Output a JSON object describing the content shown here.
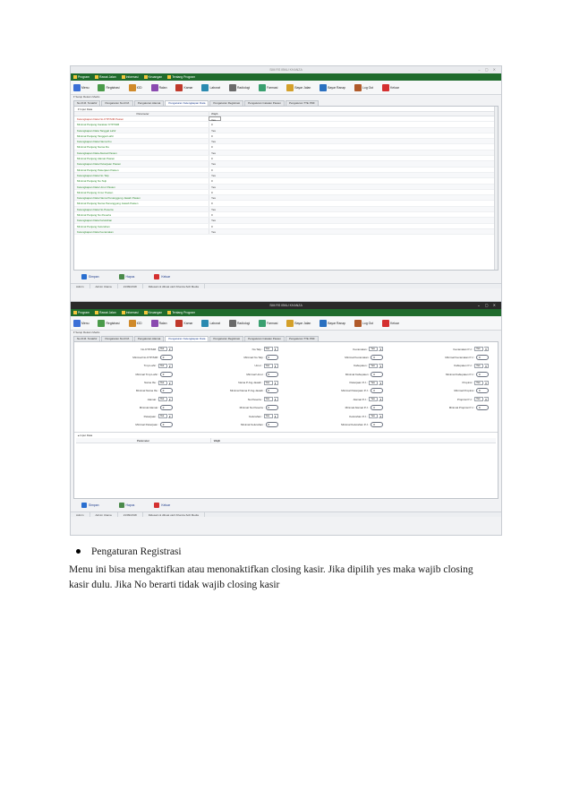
{
  "screenshot1": {
    "window_title": "SIM RS IBNU KHANZA",
    "menu": [
      "Program",
      "Rawat Jalan",
      "Informasi",
      "Keuangan",
      "Tentang Program"
    ],
    "toolbar": [
      "Menu",
      "Registrasi",
      "IGD",
      "Ralan",
      "Kamar",
      "Laborat",
      "Radiologi",
      "Farmasi",
      "Bayar Jalan",
      "Bayar Ranap",
      "Log Out",
      "Keluar"
    ],
    "breadcrumb": "Setup Rekam Medis",
    "tabs": [
      "No.R.M. Terakhir",
      "Pengaturan No.R.M.",
      "Pengaturan Alamat",
      "Pengaturan Kelengkapan Data",
      "Pengaturan Registrasi",
      "Pengaturan Catatan Pasien",
      "Pengaturan TTE PDF"
    ],
    "active_tab": 3,
    "grid_title": "Input Data",
    "grid_headers": {
      "param": "Parameter",
      "value": "Wajib"
    },
    "rows": [
      {
        "param": "Kelengkapan Data No.KTP/SIM Pasien",
        "value": "Yes",
        "selected": true
      },
      {
        "param": "Minimal Panjang Karakter KTP/SIM",
        "value": "0"
      },
      {
        "param": "Kelengkapan Data Tanggal Lahir",
        "value": "Yes"
      },
      {
        "param": "Minimal Panjang Tanggal Lahir",
        "value": "0"
      },
      {
        "param": "Kelengkapan Data Nama Ibu",
        "value": "Yes"
      },
      {
        "param": "Minimal Panjang Nama Ibu",
        "value": "0"
      },
      {
        "param": "Kelengkapan Data Alamat Pasien",
        "value": "Yes"
      },
      {
        "param": "Minimal Panjang Alamat Pasien",
        "value": "0"
      },
      {
        "param": "Kelengkapan Data Pekerjaan Pasien",
        "value": "Yes"
      },
      {
        "param": "Minimal Panjang Pekerjaan Pasien",
        "value": "0"
      },
      {
        "param": "Kelengkapan Data No.Telp",
        "value": "Yes"
      },
      {
        "param": "Minimal Panjang No.Telp",
        "value": "0"
      },
      {
        "param": "Kelengkapan Data Umur Pasien",
        "value": "Yes"
      },
      {
        "param": "Minimal Panjang Umur Pasien",
        "value": "0"
      },
      {
        "param": "Kelengkapan Data Nama Penanggung Jawab Pasien",
        "value": "Yes"
      },
      {
        "param": "Minimal Panjang Nama Penanggung Jawab Pasien",
        "value": "0"
      },
      {
        "param": "Kelengkapan Data No.Peserta",
        "value": "Yes"
      },
      {
        "param": "Minimal Panjang No.Peserta",
        "value": "0"
      },
      {
        "param": "Kelengkapan Data Kelurahan",
        "value": "Yes"
      },
      {
        "param": "Minimal Panjang Kelurahan",
        "value": "0"
      },
      {
        "param": "Kelengkapan Data Kecamatan",
        "value": "Yes"
      }
    ],
    "actions": [
      "Simpan",
      "Hapus",
      "Keluar"
    ],
    "status": [
      "Admin",
      "Admin Utama",
      "21/09/2018",
      "Didesain & dibuat oleh Khanza.Soft Media"
    ]
  },
  "screenshot2": {
    "window_title": "SIM RS IBNU KHANZA",
    "menu": [
      "Program",
      "Rawat Jalan",
      "Informasi",
      "Keuangan",
      "Tentang Program"
    ],
    "toolbar": [
      "Menu",
      "Registrasi",
      "IGD",
      "Ralan",
      "Kamar",
      "Laborat",
      "Radiologi",
      "Farmasi",
      "Bayar Jalan",
      "Bayar Ranap",
      "Log Out",
      "Keluar"
    ],
    "breadcrumb": "Setup Rekam Medis",
    "tabs": [
      "No.R.M. Terakhir",
      "Pengaturan No.R.M.",
      "Pengaturan Alamat",
      "Pengaturan Kelengkapan Data",
      "Pengaturan Registrasi",
      "Pengaturan Catatan Pasien",
      "Pengaturan TTE PDF"
    ],
    "active_tab": 3,
    "form_columns": [
      [
        {
          "label": "No.KTP/SIM :",
          "kind": "select",
          "value": "Yes"
        },
        {
          "label": "Minimal No.KTP/SIM :",
          "kind": "number",
          "value": "0"
        },
        {
          "label": "Tmp.Lahir :",
          "kind": "select",
          "value": "Yes"
        },
        {
          "label": "Minimal Tmp.Lahir :",
          "kind": "number",
          "value": "0"
        },
        {
          "label": "Nama Ibu :",
          "kind": "select",
          "value": "Yes"
        },
        {
          "label": "Minimal Nama Ibu :",
          "kind": "number",
          "value": "0"
        },
        {
          "label": "Alamat :",
          "kind": "select",
          "value": "Yes"
        },
        {
          "label": "Minimal Alamat :",
          "kind": "number",
          "value": "0"
        },
        {
          "label": "Pekerjaan :",
          "kind": "select",
          "value": "Yes"
        },
        {
          "label": "Minimal Pekerjaan :",
          "kind": "number",
          "value": "0"
        }
      ],
      [
        {
          "label": "No.Telp :",
          "kind": "select",
          "value": "Yes"
        },
        {
          "label": "Minimal No.Telp :",
          "kind": "number",
          "value": "0"
        },
        {
          "label": "Umur :",
          "kind": "select",
          "value": "Yes"
        },
        {
          "label": "Minimal Umur :",
          "kind": "number",
          "value": "0"
        },
        {
          "label": "Nama P.Jng.Jawab :",
          "kind": "select",
          "value": "Yes"
        },
        {
          "label": "Minimal Nama P.Jng.Jawab :",
          "kind": "number",
          "value": "0"
        },
        {
          "label": "No.Peserta :",
          "kind": "select",
          "value": "Yes"
        },
        {
          "label": "Minimal No.Peserta :",
          "kind": "number",
          "value": "0"
        },
        {
          "label": "Kelurahan :",
          "kind": "select",
          "value": "Yes"
        },
        {
          "label": "Minimal Kelurahan :",
          "kind": "number",
          "value": "0"
        }
      ],
      [
        {
          "label": "Kecamatan :",
          "kind": "select",
          "value": "Yes"
        },
        {
          "label": "Minimal Kecamatan :",
          "kind": "number",
          "value": "0"
        },
        {
          "label": "Kabupaten :",
          "kind": "select",
          "value": "Yes"
        },
        {
          "label": "Minimal Kabupaten :",
          "kind": "number",
          "value": "0"
        },
        {
          "label": "Pekerjaan P.J. :",
          "kind": "select",
          "value": "Yes"
        },
        {
          "label": "Minimal Pekerjaan P.J. :",
          "kind": "number",
          "value": "0"
        },
        {
          "label": "Alamat P.J. :",
          "kind": "select",
          "value": "Yes"
        },
        {
          "label": "Minimal Alamat P.J. :",
          "kind": "number",
          "value": "0"
        },
        {
          "label": "Kelurahan P.J. :",
          "kind": "select",
          "value": "Yes"
        },
        {
          "label": "Minimal Kelurahan P.J. :",
          "kind": "number",
          "value": "0"
        }
      ],
      [
        {
          "label": "Kecamatan P.J. :",
          "kind": "select",
          "value": "Yes"
        },
        {
          "label": "Minimal Kecamatan P.J. :",
          "kind": "number",
          "value": "0"
        },
        {
          "label": "Kabupaten P.J. :",
          "kind": "select",
          "value": "Yes"
        },
        {
          "label": "Minimal Kabupaten P.J. :",
          "kind": "number",
          "value": "0"
        },
        {
          "label": "Propinsi :",
          "kind": "select",
          "value": "Yes"
        },
        {
          "label": "Minimal Propinsi :",
          "kind": "number",
          "value": "0"
        },
        {
          "label": "Propinsi P.J. :",
          "kind": "select",
          "value": "Yes"
        },
        {
          "label": "Minimal Propinsi P.J. :",
          "kind": "number",
          "value": "0"
        }
      ]
    ],
    "data_title": "Input Data",
    "data_headers": {
      "param": "Parameter",
      "value": "Wajib"
    },
    "actions": [
      "Simpan",
      "Hapus",
      "Keluar"
    ],
    "status": [
      "Admin",
      "Admin Utama",
      "21/09/2018",
      "Didesain & dibuat oleh Khanza.Soft Media"
    ]
  },
  "colors": {
    "menubar": "#1f6b2c",
    "required_text": "#2d8a2d",
    "selected_text": "#c0392b",
    "link_blue": "#1e3c8c"
  },
  "document": {
    "bullet": "Pengaturan Registrasi",
    "paragraph_line1": "Menu ini bisa mengaktifkan atau menonaktifkan closing kasir. Jika dipilih yes maka wajib closing",
    "paragraph_line2": "kasir dulu. Jika No berarti tidak wajib closing kasir"
  }
}
